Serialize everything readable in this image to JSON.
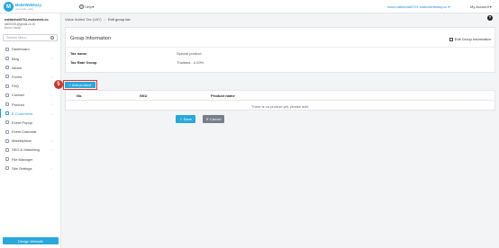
{
  "topbar": {
    "logo_name": "MakeWebEasy",
    "logo_sub": "your web, easy",
    "help_label": "Help",
    "site_link": "www.nattachai0701.makewebeasy.co",
    "account_label": "My Account"
  },
  "user": {
    "name": "nattachai0701.makeweb.co",
    "email": "kk0000f1@gmail.co.th",
    "plan": "Basic Name"
  },
  "sidebar": {
    "search_placeholder": "Search Menu",
    "items": [
      {
        "label": "Dashboard",
        "icon": "dashboard-icon",
        "chevron": false
      },
      {
        "label": "Blog",
        "icon": "blog-icon",
        "chevron": true
      },
      {
        "label": "Album",
        "icon": "album-icon",
        "chevron": false
      },
      {
        "label": "Forms",
        "icon": "forms-icon",
        "chevron": true
      },
      {
        "label": "FAQ",
        "icon": "faq-icon",
        "chevron": false
      },
      {
        "label": "Contact",
        "icon": "contact-icon",
        "chevron": true
      },
      {
        "label": "Product",
        "icon": "product-icon",
        "chevron": true
      },
      {
        "label": "E-Commerce",
        "icon": "ecommerce-icon",
        "chevron": true,
        "active": true
      },
      {
        "label": "Event Popup",
        "icon": "popup-icon",
        "chevron": false
      },
      {
        "label": "Event Calendar",
        "icon": "calendar-icon",
        "chevron": false
      },
      {
        "label": "Marketplace",
        "icon": "marketplace-icon",
        "chevron": true
      },
      {
        "label": "SEO & Marketing",
        "icon": "seo-icon",
        "chevron": true
      },
      {
        "label": "File Manager",
        "icon": "file-icon",
        "chevron": false
      },
      {
        "label": "Site Settings",
        "icon": "settings-icon",
        "chevron": true
      }
    ],
    "design_button": "Design Website"
  },
  "breadcrumb": {
    "parent": "Value Added Tax (VAT)",
    "current": "Edit group tax"
  },
  "group_info": {
    "title": "Group Information",
    "edit_label": "Edit Group Information",
    "rows": [
      {
        "label": "Tax name",
        "value": "Special product"
      },
      {
        "label": "Tax Rate Group",
        "value": "Thailand - 0.00%"
      }
    ]
  },
  "step_marker": "5",
  "add_product_label": "+ Add product",
  "product_table": {
    "headers": [
      "No.",
      "SKU",
      "Product name"
    ],
    "empty_message": "There is no product yet, please add."
  },
  "actions": {
    "save_label": "Save",
    "cancel_label": "Cancel"
  },
  "colors": {
    "accent": "#29a8dc",
    "marker": "#c0392b",
    "cancel": "#777f88"
  }
}
